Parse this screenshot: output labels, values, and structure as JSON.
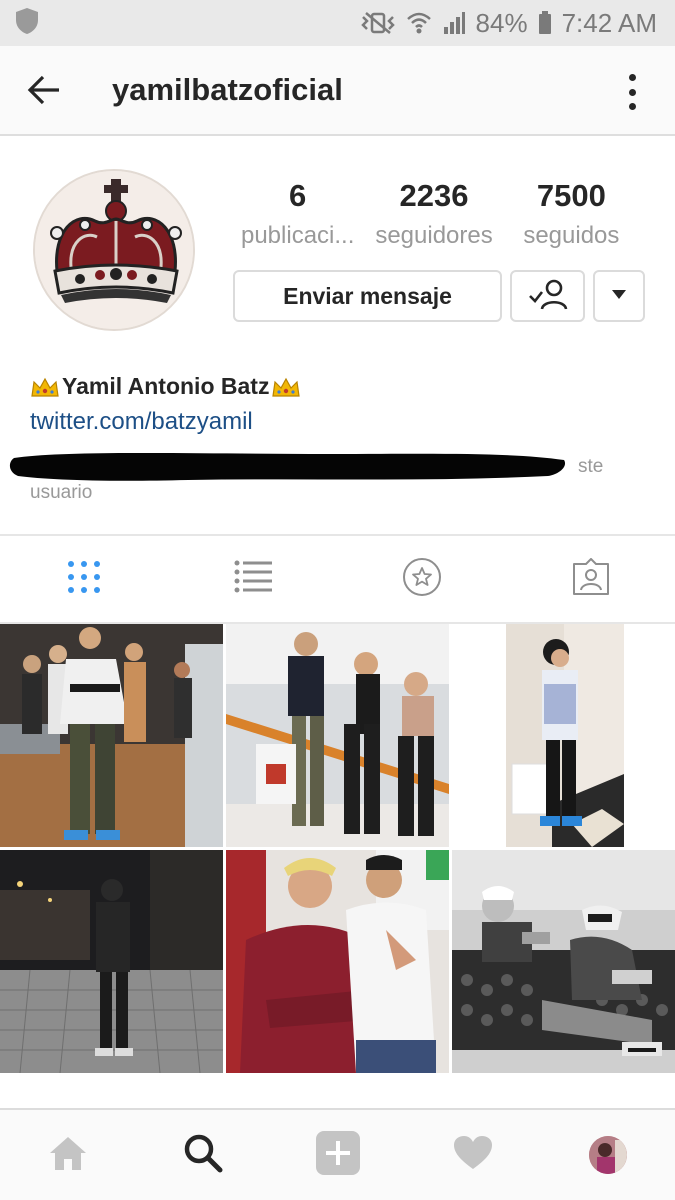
{
  "status_bar": {
    "battery": "84%",
    "time": "7:42 AM",
    "icons": [
      "shield-icon",
      "vibrate-icon",
      "wifi-icon",
      "signal-icon",
      "battery-icon"
    ]
  },
  "header": {
    "title": "yamilbatzoficial",
    "back_icon": "arrow-left-icon",
    "menu_icon": "more-vertical-icon"
  },
  "profile": {
    "stats": [
      {
        "value": "6",
        "label": "publicaci..."
      },
      {
        "value": "2236",
        "label": "seguidores"
      },
      {
        "value": "7500",
        "label": "seguidos"
      }
    ],
    "message_button": "Enviar mensaje",
    "following_icon": "user-check-icon",
    "dropdown_icon": "caret-down-icon",
    "bio": {
      "name": "Yamil Antonio Batz",
      "link": "twitter.com/batzyamil",
      "hint_end": "ste",
      "hint_line2": "usuario"
    }
  },
  "tabs": [
    {
      "name": "grid",
      "icon": "grid-icon",
      "active": true
    },
    {
      "name": "list",
      "icon": "list-icon",
      "active": false
    },
    {
      "name": "saved",
      "icon": "star-circle-icon",
      "active": false
    },
    {
      "name": "tagged",
      "icon": "tagged-user-icon",
      "active": false
    }
  ],
  "posts_count_visible": 6,
  "bottom_nav": [
    {
      "name": "home",
      "icon": "home-icon"
    },
    {
      "name": "search",
      "icon": "search-icon"
    },
    {
      "name": "add",
      "icon": "plus-square-icon"
    },
    {
      "name": "activity",
      "icon": "heart-icon"
    },
    {
      "name": "profile",
      "icon": "avatar"
    }
  ],
  "colors": {
    "link": "#1d4f86",
    "active_tab": "#3897f0",
    "muted_text": "#999999",
    "status_bar_bg": "#e9e9e9"
  }
}
